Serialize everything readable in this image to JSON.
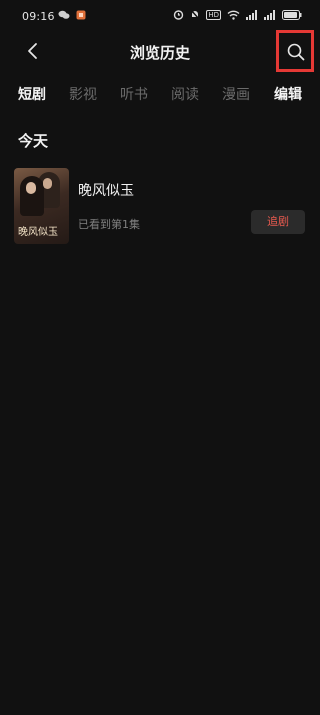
{
  "status_bar": {
    "time": "09:16",
    "left_icons": [
      "wechat-icon",
      "app-notification-icon"
    ],
    "right_icons": [
      "alarm-icon",
      "silent-icon",
      "hd-icon",
      "wifi-icon",
      "signal-icon",
      "signal-icon",
      "battery-icon"
    ],
    "hd_label": "HD"
  },
  "header": {
    "title": "浏览历史",
    "back_icon": "chevron-left-icon",
    "search_icon": "search-icon",
    "highlight_color": "#e53935"
  },
  "tabs": {
    "items": [
      {
        "label": "短剧",
        "active": true
      },
      {
        "label": "影视",
        "active": false
      },
      {
        "label": "听书",
        "active": false
      },
      {
        "label": "阅读",
        "active": false
      },
      {
        "label": "漫画",
        "active": false
      }
    ],
    "edit_label": "编辑"
  },
  "sections": [
    {
      "title": "今天",
      "items": [
        {
          "title": "晚风似玉",
          "poster_text": "晚风似玉",
          "progress": "已看到第1集",
          "action_label": "追剧"
        }
      ]
    }
  ],
  "colors": {
    "background": "#111111",
    "accent": "#e85a4f"
  }
}
